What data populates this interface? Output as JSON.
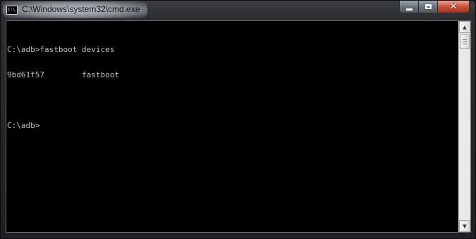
{
  "window": {
    "title": "C:\\Windows\\system32\\cmd.exe",
    "icon": "console-app-icon",
    "icon_text": "C:\\",
    "controls": {
      "minimize_icon": "minimize-icon",
      "maximize_icon": "maximize-icon",
      "close_icon": "close-icon",
      "close_glyph": "✕"
    }
  },
  "console": {
    "lines": [
      "C:\\adb>fastboot devices",
      "9bd61f57        fastboot",
      "",
      "C:\\adb>"
    ],
    "text_color": "#c0c0c0",
    "background_color": "#000000"
  },
  "scrollbar": {
    "up_arrow": "▲",
    "down_arrow": "▼"
  },
  "colors": {
    "close_button": "#c9513a",
    "title_bar": "#2a2c30"
  }
}
